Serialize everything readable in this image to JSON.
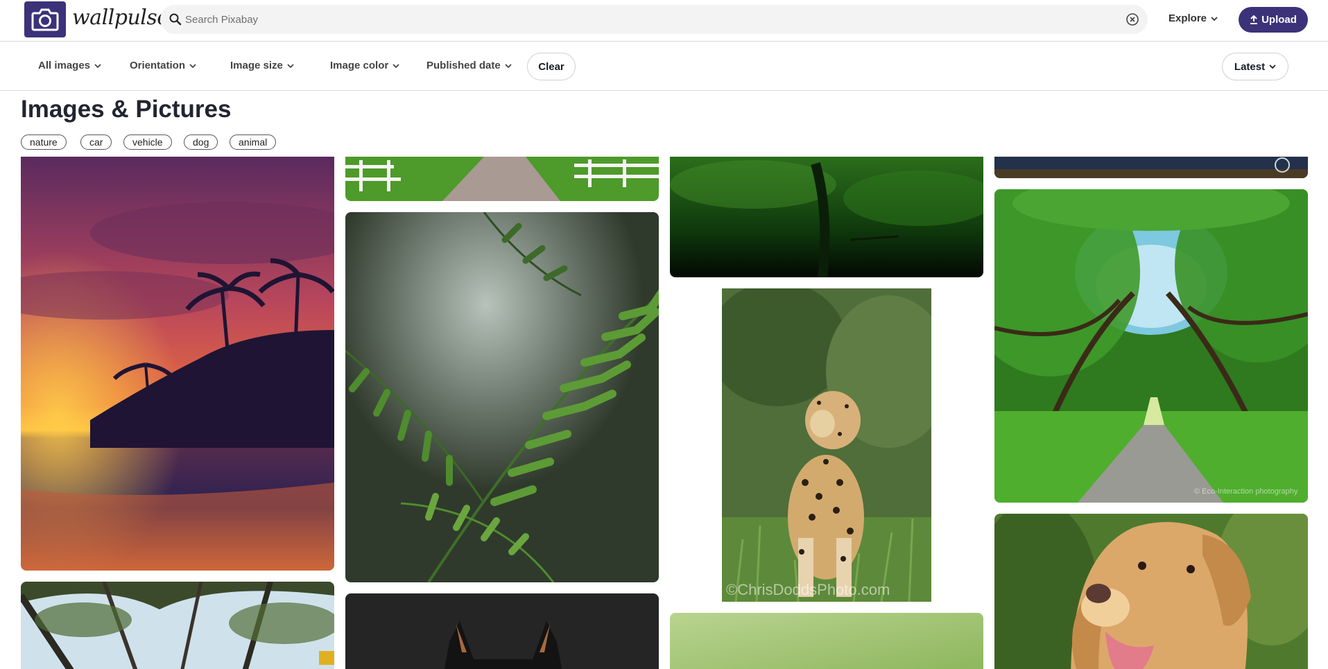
{
  "header": {
    "brand": "wallpulse",
    "search_placeholder": "Search Pixabay",
    "explore_label": "Explore",
    "upload_label": "Upload"
  },
  "filters": {
    "items": [
      "All images",
      "Orientation",
      "Image size",
      "Image color",
      "Published date"
    ],
    "clear_label": "Clear",
    "sort_label": "Latest"
  },
  "main": {
    "title": "Images & Pictures",
    "tags": [
      "nature",
      "car",
      "vehicle",
      "dog",
      "animal"
    ]
  },
  "gallery": {
    "watermark_leopard": "©ChrisDoddsPhoto.com",
    "watermark_path": "© Eco-Interaction photography"
  },
  "colors": {
    "brand": "#3c3279",
    "border": "#d8d8d8"
  },
  "icons": {
    "logo": "camera-icon",
    "search": "search-icon",
    "clear": "clear-circle-icon",
    "upload": "upload-icon",
    "dropdown": "chevron-down-icon"
  }
}
